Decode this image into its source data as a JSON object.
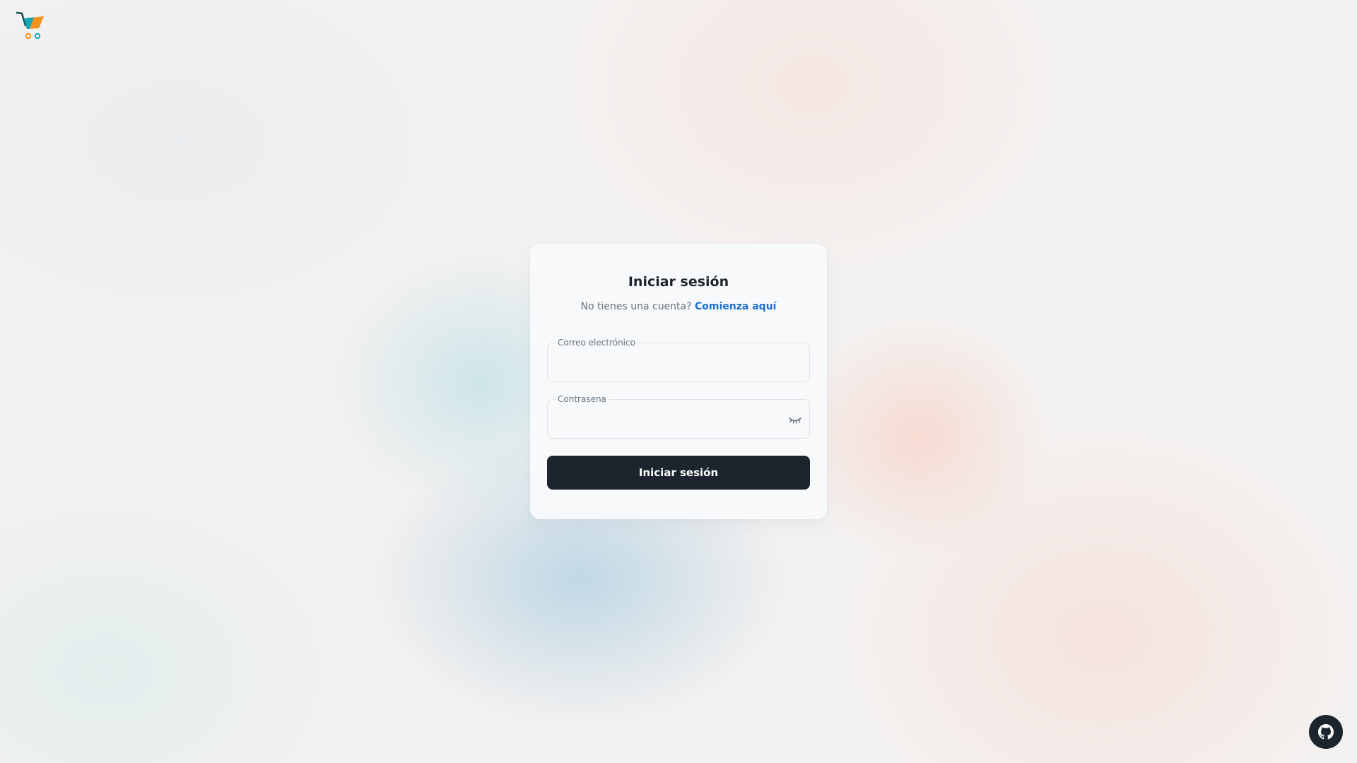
{
  "brand": {
    "logo_icon": "shopping-cart-logo",
    "colors": {
      "cart_frame": "#1c4a5a",
      "cart_basket_orange": "#f7941d",
      "cart_basket_teal": "#13a8b5"
    }
  },
  "login": {
    "title": "Iniciar sesión",
    "signup_prompt": "No tienes una cuenta?",
    "signup_link": "Comienza aquí",
    "email": {
      "label": "Correo electrónico",
      "value": ""
    },
    "password": {
      "label": "Contrasena",
      "value": "",
      "toggle_icon": "eye-closed-icon"
    },
    "submit_label": "Iniciar sesión"
  },
  "footer": {
    "github_icon": "github-icon"
  },
  "theme": {
    "primary_dark": "#1c252e",
    "link_blue": "#1f6fd1",
    "text_secondary": "#637381",
    "card_bg": "#f8f9fa",
    "border": "#dfe3e8"
  }
}
